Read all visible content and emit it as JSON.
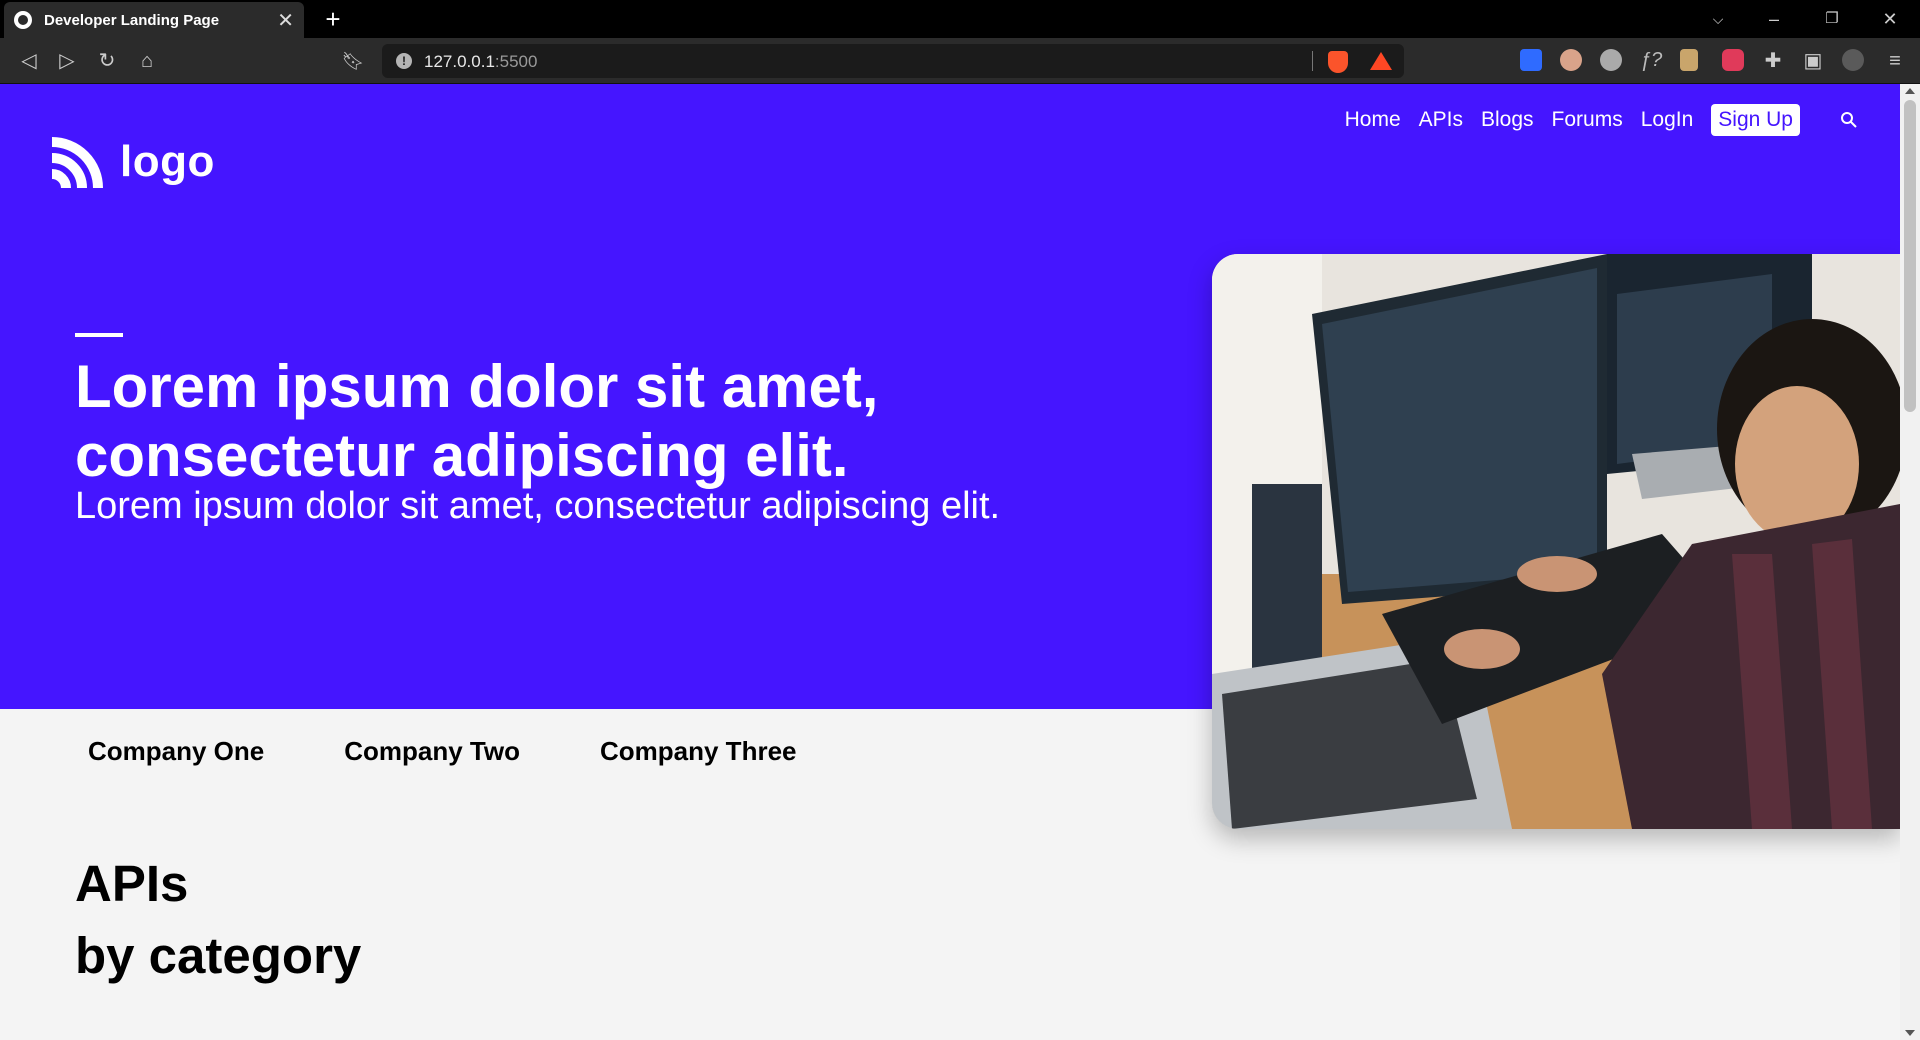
{
  "browser": {
    "tab_title": "Developer Landing Page",
    "url_host": "127.0.0.1",
    "url_port": ":5500"
  },
  "page": {
    "logo_text": "logo",
    "nav": [
      "Home",
      "APIs",
      "Blogs",
      "Forums",
      "LogIn"
    ],
    "signup_label": "Sign Up",
    "hero": {
      "title": "Lorem ipsum dolor sit amet, consectetur adipiscing elit.",
      "subtitle": "Lorem ipsum dolor sit amet, consectetur adipiscing elit."
    },
    "companies": [
      "Company One",
      "Company Two",
      "Company Three"
    ],
    "apis_title_line1": "APIs",
    "apis_title_line2": "by category"
  },
  "colors": {
    "brand": "#4515ff",
    "page_bg": "#f4f4f4",
    "chrome_bg": "#2b2b2b"
  }
}
